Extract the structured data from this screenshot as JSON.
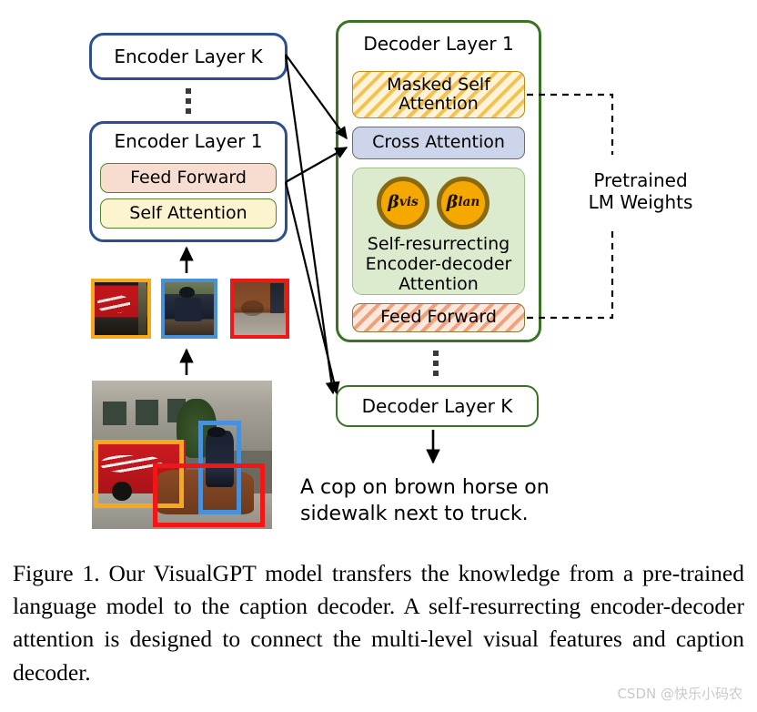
{
  "figure": {
    "encoder": {
      "top_layer_label": "Encoder Layer K",
      "bottom_layer_label": "Encoder Layer 1",
      "blocks": [
        {
          "label": "Feed Forward",
          "style": "plain-peach"
        },
        {
          "label": "Self Attention",
          "style": "plain-yellow"
        }
      ],
      "ellipsis": "⋮",
      "border_color": "#2e4f8f"
    },
    "decoder": {
      "top_layer_label": "Decoder Layer 1",
      "bottom_layer_label": "Decoder Layer K",
      "ellipsis": "⋮",
      "border_color": "#3a7326",
      "blocks": [
        {
          "label": "Masked Self\nAttention",
          "style": "hatched-yellow"
        },
        {
          "label": "Cross Attention",
          "style": "solid-blue"
        },
        {
          "label": "Feed Forward",
          "style": "hatched-orange"
        }
      ],
      "srd": {
        "label_line1": "Self-resurrecting",
        "label_line2": "Encoder-decoder",
        "label_line3": "Attention",
        "background": "#dceace",
        "betas": [
          {
            "symbol": "β",
            "superscript": "vis",
            "fill": "#f5a800",
            "stroke": "#8a6a10"
          },
          {
            "symbol": "β",
            "superscript": "lan",
            "fill": "#f5a800",
            "stroke": "#8a6a10"
          }
        ]
      }
    },
    "pretrained_label": {
      "line1": "Pretrained",
      "line2": "LM Weights"
    },
    "generated_caption": {
      "line1": "A cop on brown horse on",
      "line2": "sidewalk next to truck."
    },
    "region_crops": [
      {
        "name": "coca-cola-truck-crop",
        "border_color": "#f7a81b"
      },
      {
        "name": "police-officer-crop",
        "border_color": "#4a90d9"
      },
      {
        "name": "brown-horse-crop",
        "border_color": "#f21616"
      }
    ],
    "input_image": {
      "name": "street-scene-cop-on-horse-next-to-coca-cola-truck",
      "boxes": [
        {
          "name": "truck-box",
          "color": "#f7a81b"
        },
        {
          "name": "officer-box",
          "color": "#4a90d9"
        },
        {
          "name": "horse-box",
          "color": "#f21616"
        }
      ]
    }
  },
  "caption": {
    "label": "Figure 1.",
    "text": "Our VisualGPT model transfers the knowledge from a pre-trained language model to the caption decoder. A self-resurrecting encoder-decoder attention is designed to connect the multi-level visual features and caption decoder."
  },
  "watermark": {
    "text": "CSDN @快乐小码农"
  }
}
